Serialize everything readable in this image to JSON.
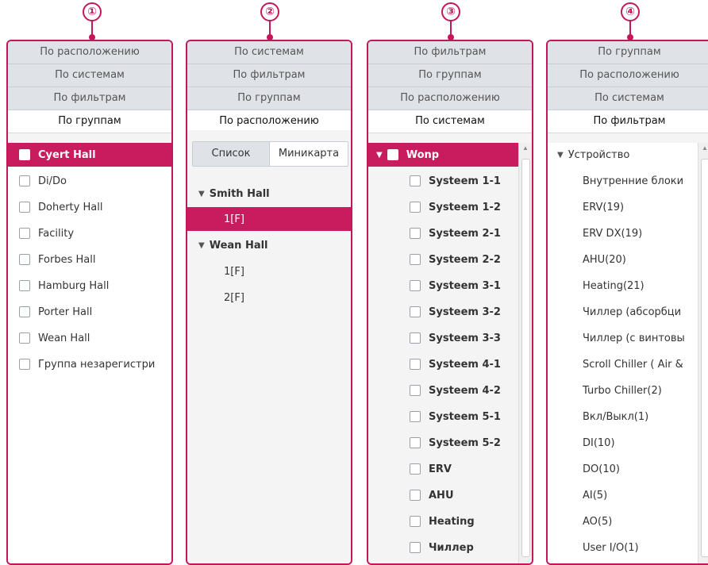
{
  "callouts": [
    "①",
    "②",
    "③",
    "④"
  ],
  "accent_color": "#c81c5e",
  "panel1": {
    "tabs": [
      "По расположению",
      "По системам",
      "По фильтрам"
    ],
    "active_tab": "По группам",
    "items": [
      "Cyert Hall",
      "Di/Do",
      "Doherty Hall",
      "Facility",
      "Forbes Hall",
      "Hamburg Hall",
      "Porter Hall",
      "Wean Hall",
      "Группа незарегистри"
    ],
    "selected_index": 0
  },
  "panel2": {
    "tabs": [
      "По системам",
      "По фильтрам",
      "По группам"
    ],
    "active_tab": "По расположению",
    "segment": {
      "list_label": "Список",
      "minimap_label": "Миникарта"
    },
    "tree": [
      {
        "label": "Smith Hall",
        "children": [
          "1[F]"
        ]
      },
      {
        "label": "Wean Hall",
        "children": [
          "1[F]",
          "2[F]"
        ]
      }
    ]
  },
  "panel3": {
    "tabs": [
      "По фильтрам",
      "По группам",
      "По расположению"
    ],
    "active_tab": "По системам",
    "root": "Wonp",
    "items": [
      "Systeem 1-1",
      "Systeem 1-2",
      "Systeem 2-1",
      "Systeem 2-2",
      "Systeem 3-1",
      "Systeem 3-2",
      "Systeem 3-3",
      "Systeem 4-1",
      "Systeem 4-2",
      "Systeem 5-1",
      "Systeem 5-2",
      "ERV",
      "AHU",
      "Heating",
      "Чиллер"
    ]
  },
  "panel4": {
    "tabs": [
      "По группам",
      "По расположению",
      "По системам"
    ],
    "active_tab": "По фильтрам",
    "root": "Устройство",
    "items": [
      "Внутренние блоки",
      "ERV(19)",
      "ERV DX(19)",
      "AHU(20)",
      "Heating(21)",
      "Чиллер (абсорбци",
      "Чиллер (с винтовы",
      "Scroll Chiller ( Air &",
      "Turbo Chiller(2)",
      "Вкл/Выкл(1)",
      "DI(10)",
      "DO(10)",
      "AI(5)",
      "AO(5)",
      "User I/O(1)"
    ]
  }
}
